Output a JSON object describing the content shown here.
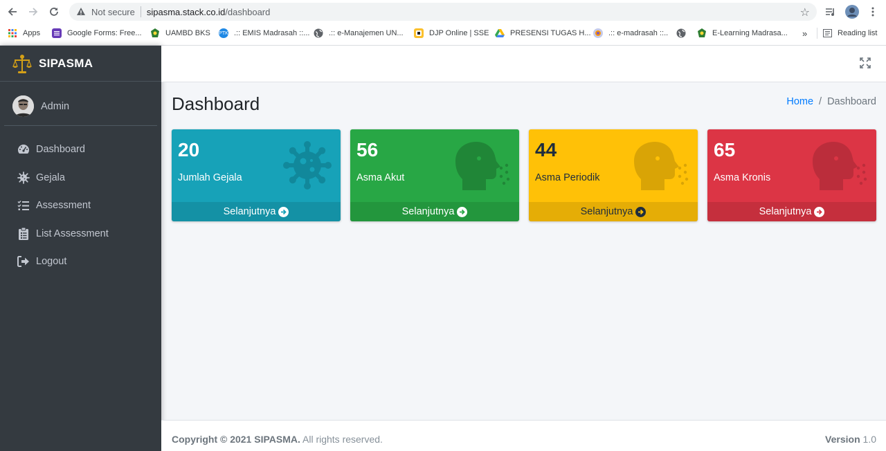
{
  "browser": {
    "security_label": "Not secure",
    "url_host": "sipasma.stack.co.id",
    "url_path": "/dashboard",
    "bookmarks": [
      {
        "label": "Apps",
        "icon": "apps-grid-icon"
      },
      {
        "label": "Google Forms: Free...",
        "icon": "google-forms-icon"
      },
      {
        "label": "UAMBD BKS",
        "icon": "kemenag-logo-icon"
      },
      {
        "label": ".:: EMIS Madrasah ::...",
        "icon": "emis-icon"
      },
      {
        "label": ".:: e-Manajemen UN...",
        "icon": "globe-icon"
      },
      {
        "label": "DJP Online | SSE",
        "icon": "djp-icon"
      },
      {
        "label": "PRESENSI TUGAS H...",
        "icon": "google-drive-icon"
      },
      {
        "label": ".:: e-madrasah ::..",
        "icon": "emadrasah-icon"
      },
      {
        "label": "",
        "icon": "globe-icon"
      },
      {
        "label": "E-Learning Madrasa...",
        "icon": "kemenag-logo-icon"
      }
    ],
    "more_bookmarks": "»",
    "reading_list": "Reading list"
  },
  "sidebar": {
    "brand": "SIPASMA",
    "user": "Admin",
    "items": [
      {
        "label": "Dashboard",
        "icon": "tachometer-icon"
      },
      {
        "label": "Gejala",
        "icon": "virus-icon"
      },
      {
        "label": "Assessment",
        "icon": "tasks-icon"
      },
      {
        "label": "List Assessment",
        "icon": "clipboard-list-icon"
      },
      {
        "label": "Logout",
        "icon": "sign-out-icon"
      }
    ]
  },
  "header": {
    "title": "Dashboard",
    "breadcrumb": {
      "home": "Home",
      "separator": "/",
      "current": "Dashboard"
    }
  },
  "cards": [
    {
      "value": "20",
      "label": "Jumlah Gejala",
      "link": "Selanjutnya",
      "color": "#17a2b8",
      "icon": "virus-icon"
    },
    {
      "value": "56",
      "label": "Asma Akut",
      "link": "Selanjutnya",
      "color": "#28a745",
      "icon": "head-side-cough-icon"
    },
    {
      "value": "44",
      "label": "Asma Periodik",
      "link": "Selanjutnya",
      "color": "#ffc107",
      "icon": "head-side-cough-icon"
    },
    {
      "value": "65",
      "label": "Asma Kronis",
      "link": "Selanjutnya",
      "color": "#dc3545",
      "icon": "head-side-cough-icon"
    }
  ],
  "footer": {
    "copyright_prefix": "Copyright © 2021 SIPASMA.",
    "copyright_suffix": " All rights reserved.",
    "version_label": "Version",
    "version_value": " 1.0"
  }
}
